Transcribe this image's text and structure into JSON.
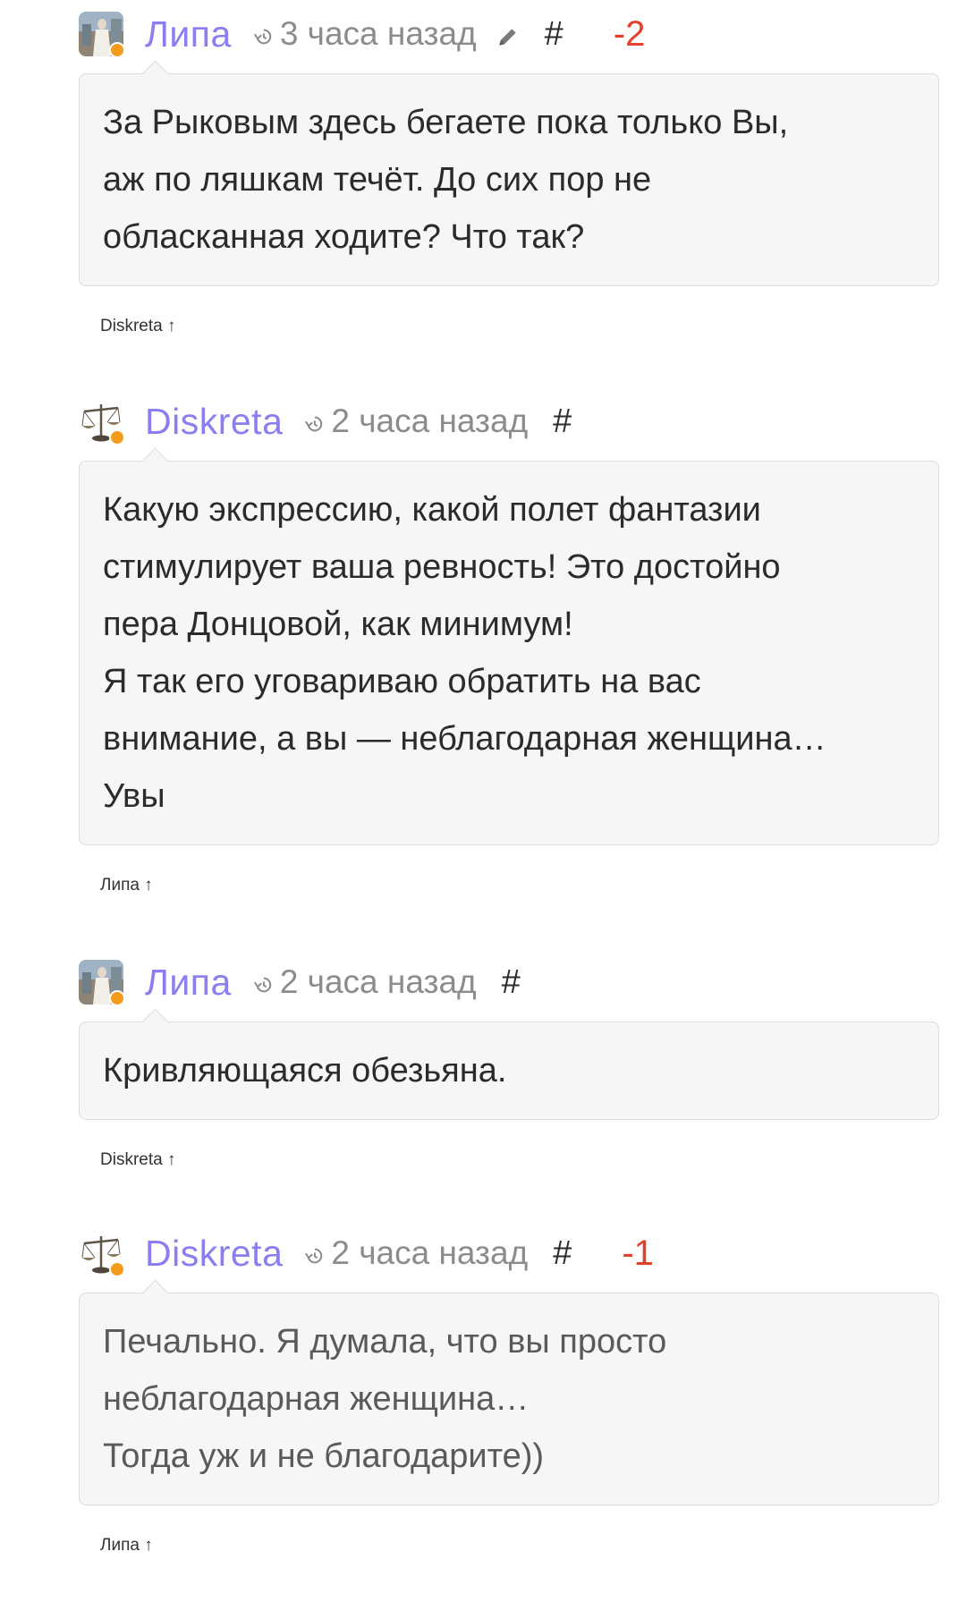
{
  "colors": {
    "author": "#8a7ef0",
    "score_negative": "#e2402b",
    "status_online": "#f39c1b",
    "bubble_bg": "#f6f6f7",
    "muted": "#8c8c8c"
  },
  "comments": [
    {
      "author": "Липа",
      "avatar_icon": "user-photo-avatar",
      "time": "3 часа назад",
      "edited": true,
      "anchor": "#",
      "score": "-2",
      "lines": [
        "За Рыковым здесь бегаете пока только Вы,",
        "аж по ляшкам течёт. До сих пор не",
        "обласканная ходите? Что так?"
      ],
      "reply": "Diskreta ↑"
    },
    {
      "author": "Diskreta",
      "avatar_icon": "scales-avatar",
      "time": "2 часа назад",
      "edited": false,
      "anchor": "#",
      "score": "",
      "lines": [
        "Какую экспрессию, какой полет фантазии",
        "стимулирует ваша ревность! Это достойно",
        "пера Донцовой, как минимум!",
        "Я так его уговариваю обратить на вас",
        "внимание, а вы — неблагодарная женщина…",
        "Увы"
      ],
      "reply": "Липа ↑"
    },
    {
      "author": "Липа",
      "avatar_icon": "user-photo-avatar",
      "time": "2 часа назад",
      "edited": false,
      "anchor": "#",
      "score": "",
      "lines": [
        "Кривляющаяся обезьяна."
      ],
      "reply": "Diskreta ↑"
    },
    {
      "author": "Diskreta",
      "avatar_icon": "scales-avatar",
      "time": "2 часа назад",
      "edited": false,
      "anchor": "#",
      "score": "-1",
      "lines": [
        "Печально. Я думала, что вы просто",
        "неблагодарная женщина…",
        "Тогда уж и не благодарите))"
      ],
      "reply": "Липа ↑"
    }
  ]
}
